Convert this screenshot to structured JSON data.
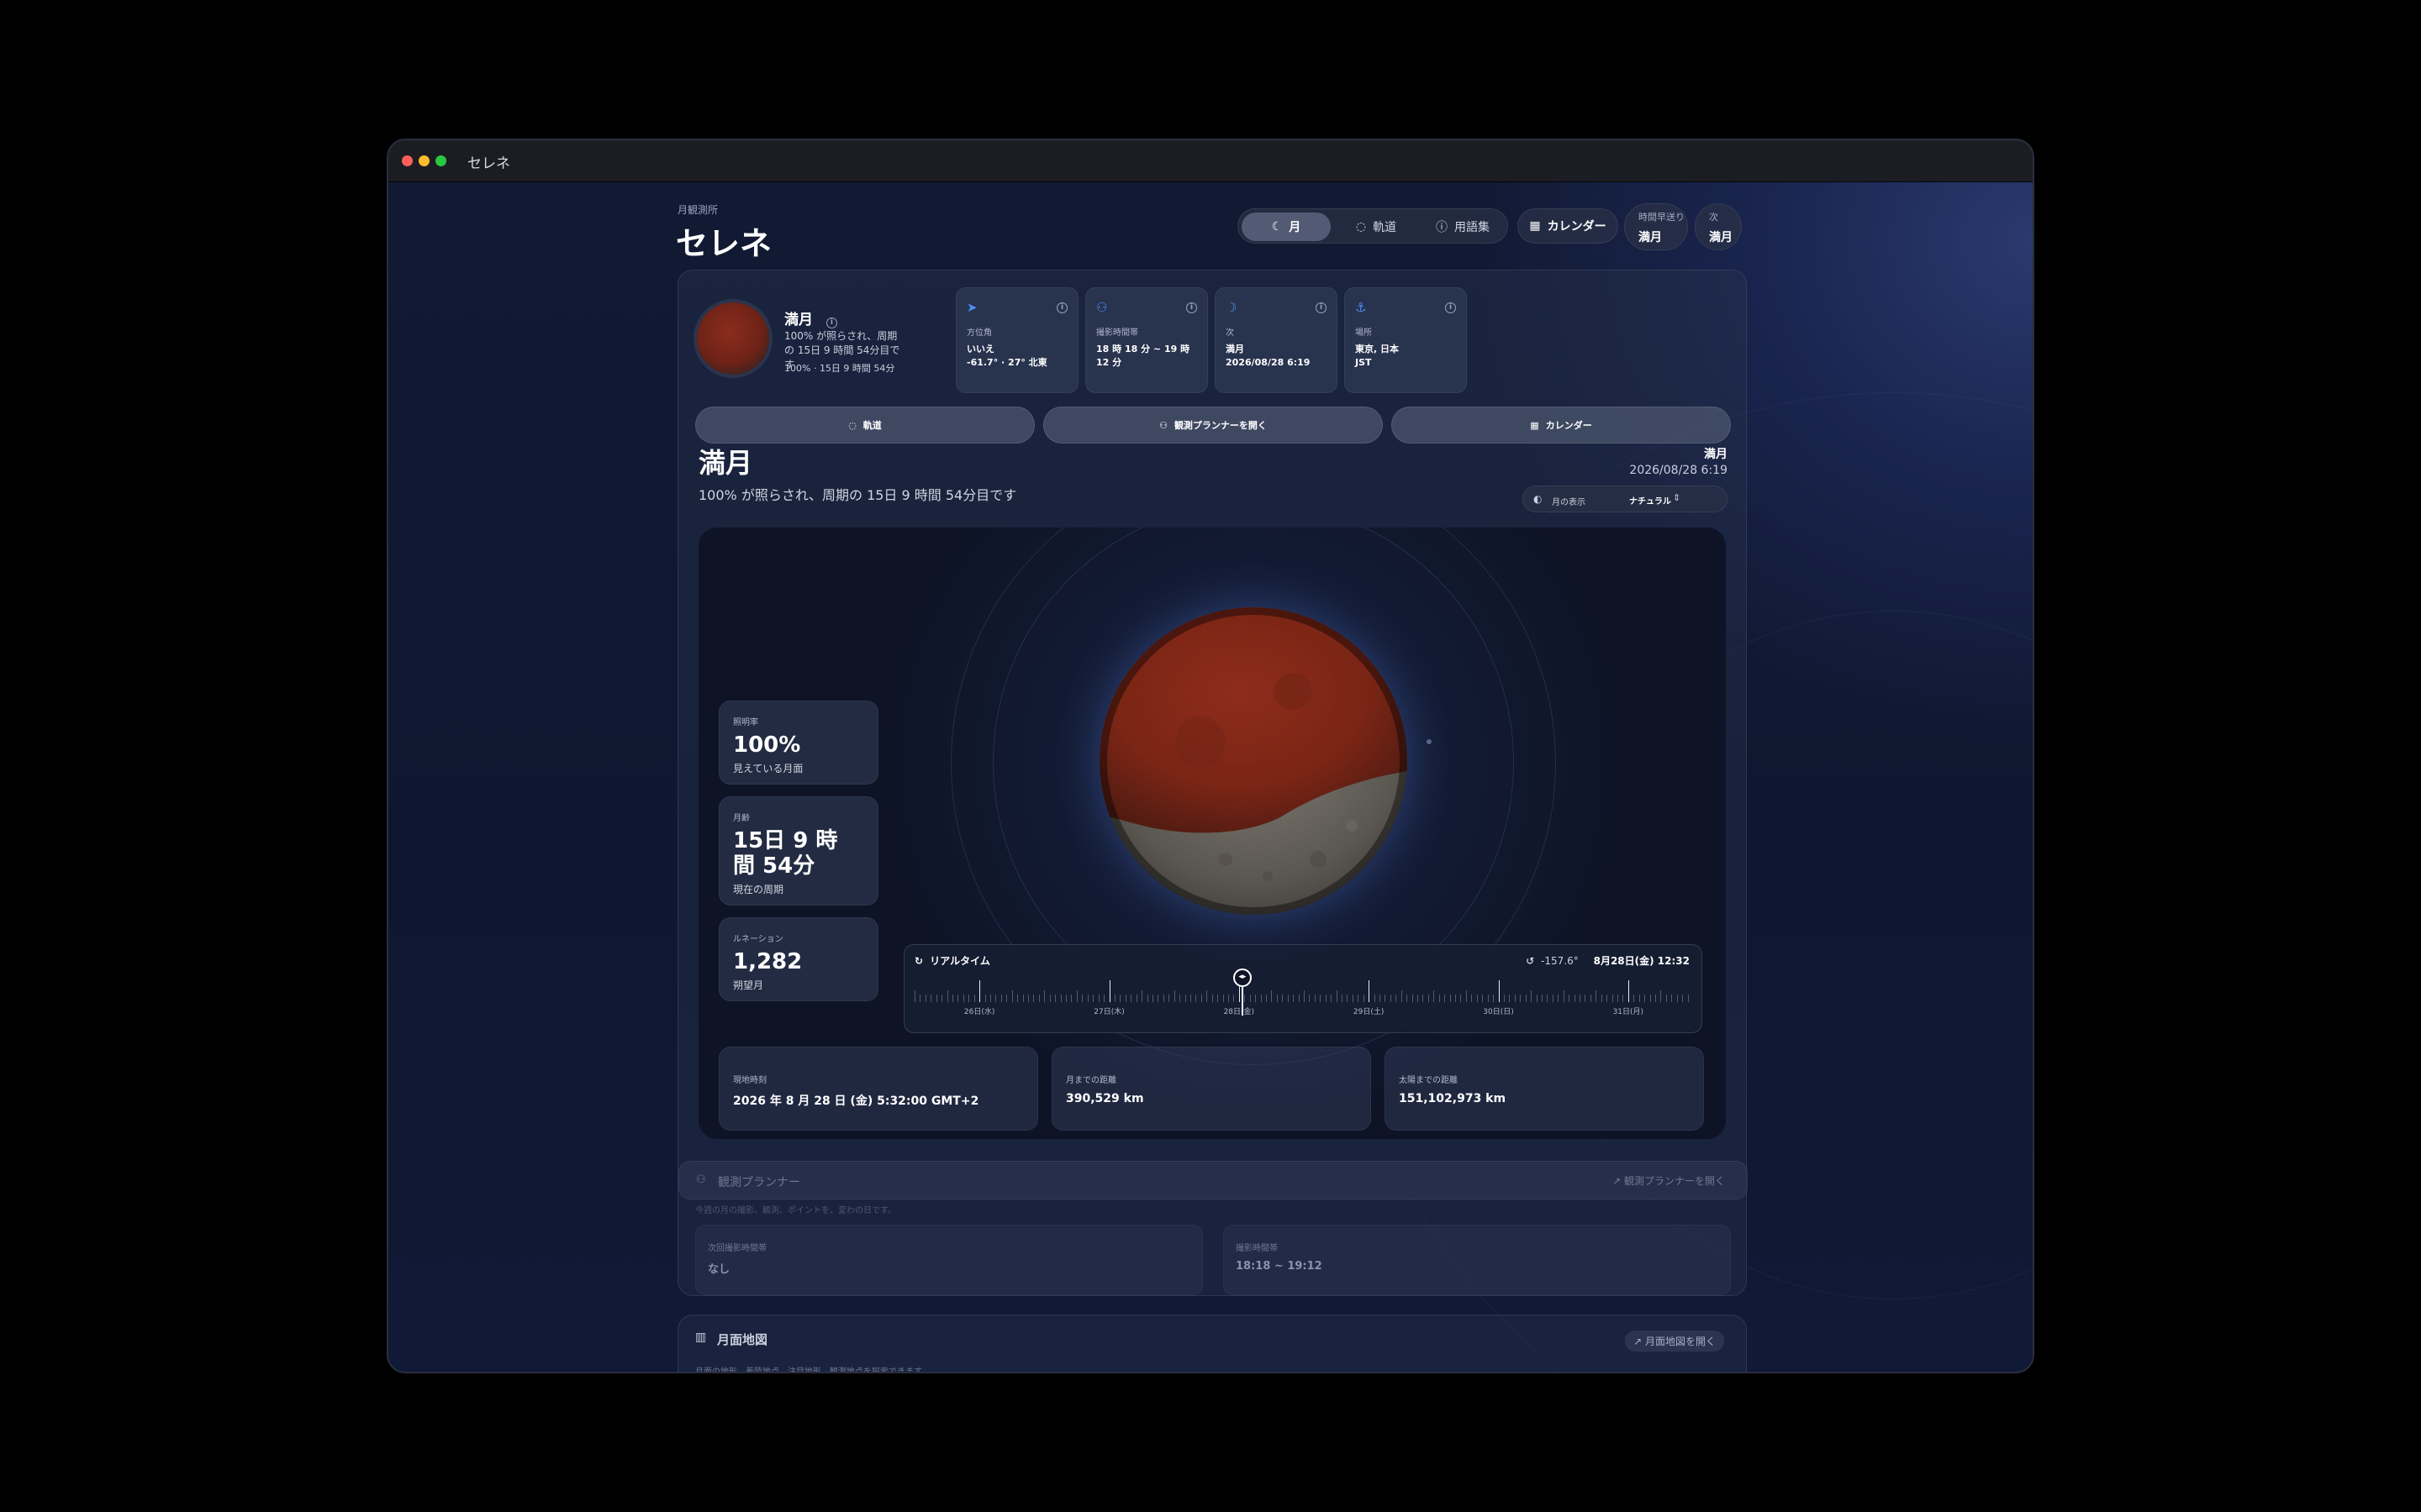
{
  "window": {
    "title": "セレネ"
  },
  "header": {
    "supertitle": "月観測所",
    "title": "セレネ",
    "segments": [
      {
        "label": "月",
        "icon": "moon-icon",
        "active": true
      },
      {
        "label": "軌道",
        "icon": "orbit-icon",
        "active": false
      },
      {
        "label": "用語集",
        "icon": "help-icon",
        "active": false
      }
    ],
    "calendar_label": "カレンダー",
    "timewarp": {
      "label": "時間早送り",
      "value": "満月"
    },
    "next": {
      "label": "次",
      "value": "満月"
    }
  },
  "summary": {
    "phase_name": "満月",
    "phase_desc": "100% が照らされ、周期の 15日 9 時間 54分目です",
    "phase_sub": "100% · 15日 9 時間 54分",
    "cards": [
      {
        "icon": "compass-icon",
        "label": "方位角",
        "value_line1": "いいえ",
        "value_line2": "-61.7° · 27° 北東"
      },
      {
        "icon": "binoculars-icon",
        "label": "撮影時間帯",
        "value_line1": "18 時 18 分 ~ 19 時 12 分",
        "value_line2": ""
      },
      {
        "icon": "moon-next-icon",
        "label": "次",
        "value_line1": "満月",
        "value_line2": "2026/08/28 6:19"
      },
      {
        "icon": "location-icon",
        "label": "場所",
        "value_line1": "東京, 日本",
        "value_line2": "JST"
      }
    ],
    "actions": [
      {
        "label": "軌道",
        "icon": "orbit-icon"
      },
      {
        "label": "観測プランナーを開く",
        "icon": "binoculars-icon"
      },
      {
        "label": "カレンダー",
        "icon": "calendar-icon"
      }
    ]
  },
  "detail": {
    "title": "満月",
    "desc": "100% が照らされ、周期の 15日 9 時間 54分目です",
    "tag": "満月",
    "date": "2026/08/28 6:19",
    "display": {
      "label": "月の表示",
      "value": "ナチュラル"
    }
  },
  "stats": [
    {
      "label": "照明率",
      "value": "100%",
      "sub": "見えている月面"
    },
    {
      "label": "月齢",
      "value": "15日 9 時間 54分",
      "sub": "現在の周期"
    },
    {
      "label": "ルネーション",
      "value": "1,282",
      "sub": "朔望月"
    }
  ],
  "timeline": {
    "mode": "リアルタイム",
    "offset": "-157.6°",
    "datetime": "8月28日(金) 12:32",
    "days": [
      "26日(水)",
      "27日(木)",
      "28日(金)",
      "29日(土)",
      "30日(日)",
      "31日(月)"
    ],
    "position": 0.42
  },
  "bottom": [
    {
      "label": "現地時刻",
      "value": "2026 年 8 月 28 日 (金) 5:32:00 GMT+2"
    },
    {
      "label": "月までの距離",
      "value": "390,529 km"
    },
    {
      "label": "太陽までの距離",
      "value": "151,102,973 km"
    }
  ],
  "planner": {
    "title": "観測プランナー",
    "open_label": "観測プランナーを開く",
    "desc": "今週の月の撮影、観測、ポイントを、変わの日です。",
    "cards": [
      {
        "label": "次回撮影時間帯",
        "value": "なし"
      },
      {
        "label": "撮影時間帯",
        "value": "18:18 ~ 19:12"
      }
    ]
  },
  "map_section": {
    "title": "月面地図",
    "open_label": "月面地図を開く",
    "desc": "月面の地形、着陸地点、注目地形、観測地点を探索できます。"
  },
  "colors": {
    "accent": "#4e8df5",
    "moon_red": "#8a2d1e",
    "background": "#111a33"
  }
}
